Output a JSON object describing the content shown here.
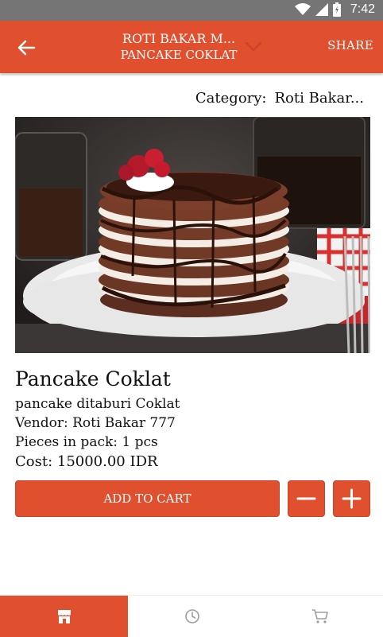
{
  "status_bar": {
    "time": "7:42"
  },
  "app_bar": {
    "title_line1": "ROTI BAKAR M...",
    "title_line2": "PANCAKE COKLAT",
    "share_label": "SHARE"
  },
  "category": {
    "label": "Category:",
    "value": "Roti Bakar..."
  },
  "product": {
    "name": "Pancake Coklat",
    "description": "pancake ditaburi Coklat",
    "vendor": "Vendor: Roti Bakar 777",
    "pieces": "Pieces in pack: 1 pcs",
    "cost": "Cost: 15000.00  IDR"
  },
  "actions": {
    "add_to_cart": "ADD TO CART"
  },
  "bottom_nav": [
    {
      "icon": "store-icon",
      "active": true
    },
    {
      "icon": "clock-icon",
      "active": false
    },
    {
      "icon": "cart-icon",
      "active": false
    }
  ],
  "colors": {
    "primary": "#e0502f",
    "status_bar": "#757575",
    "nav_icon_inactive": "#9e9e9e"
  }
}
